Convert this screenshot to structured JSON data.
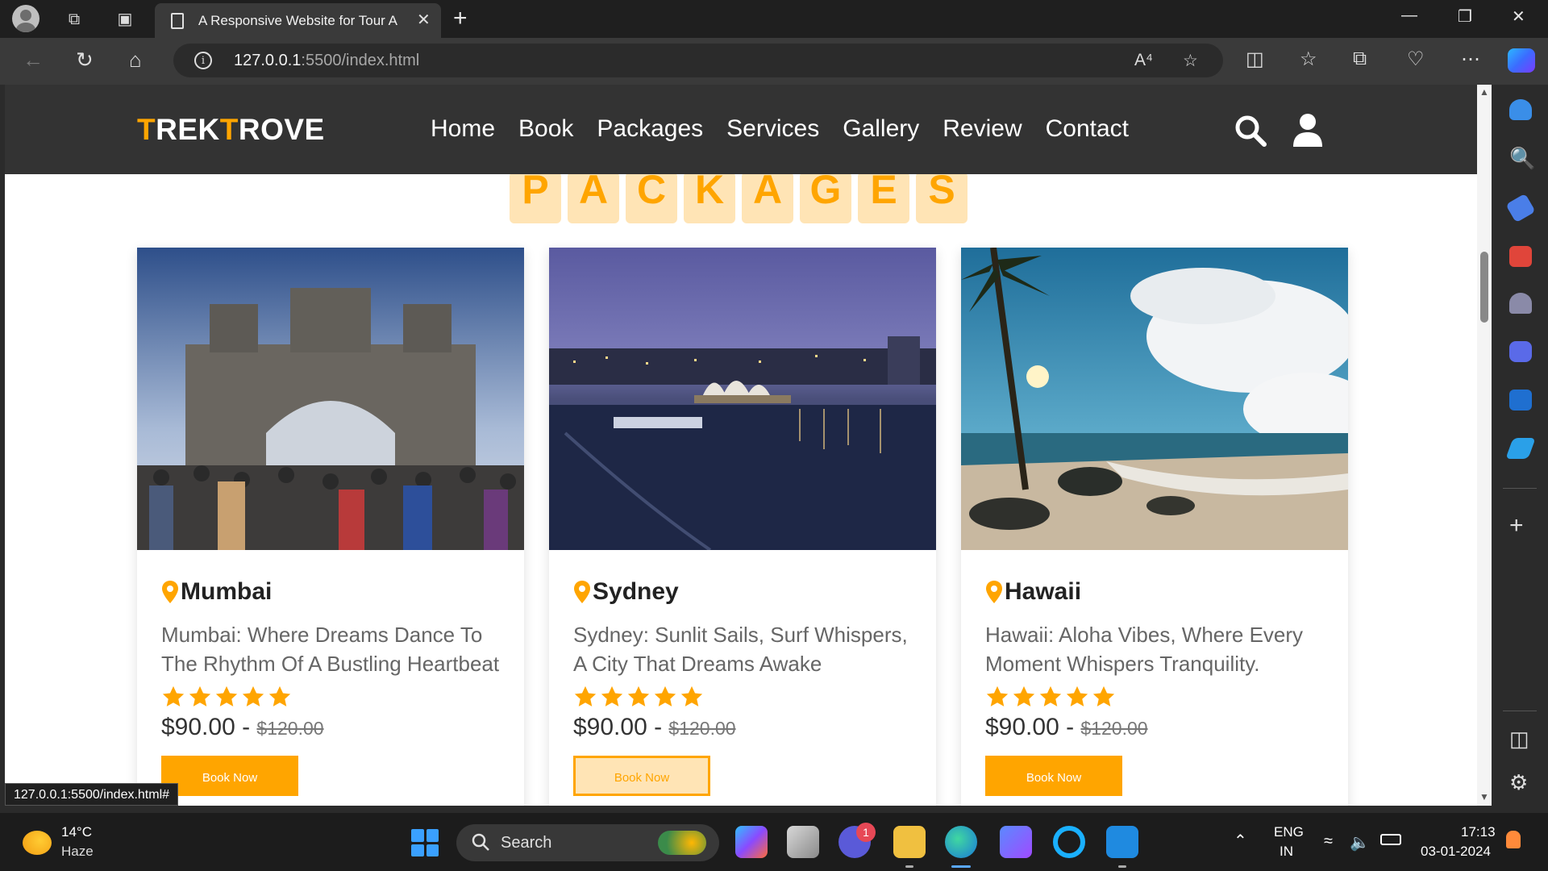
{
  "browser": {
    "tab_title": "A Responsive Website for Tour A",
    "url_host": "127.0.0.1",
    "url_path": ":5500/index.html",
    "status_url": "127.0.0.1:5500/index.html#"
  },
  "site": {
    "logo_part1": "T",
    "logo_part2": "REK",
    "logo_part3": "T",
    "logo_part4": "ROVE",
    "accent_color": "#ffa500",
    "nav": [
      "Home",
      "Book",
      "Packages",
      "Services",
      "Gallery",
      "Review",
      "Contact"
    ],
    "heading_letters": [
      "P",
      "A",
      "C",
      "K",
      "A",
      "G",
      "E",
      "S"
    ],
    "cards": [
      {
        "title": "Mumbai",
        "desc": "Mumbai: Where Dreams Dance To The Rhythm Of A Bustling Heartbeat",
        "rating": 5,
        "price": "$90.00 - ",
        "old_price": "$120.00",
        "button": "Book Now"
      },
      {
        "title": "Sydney",
        "desc": "Sydney: Sunlit Sails, Surf Whispers, A City That Dreams Awake",
        "rating": 5,
        "price": "$90.00 - ",
        "old_price": "$120.00",
        "button": "Book Now"
      },
      {
        "title": "Hawaii",
        "desc": "Hawaii: Aloha Vibes, Where Every Moment Whispers Tranquility.",
        "rating": 5,
        "price": "$90.00 - ",
        "old_price": "$120.00",
        "button": "Book Now"
      }
    ]
  },
  "taskbar": {
    "temperature": "14°C",
    "condition": "Haze",
    "search_placeholder": "Search",
    "chat_badge": "1",
    "language": "ENG",
    "region": "IN",
    "time": "17:13",
    "date": "03-01-2024"
  }
}
